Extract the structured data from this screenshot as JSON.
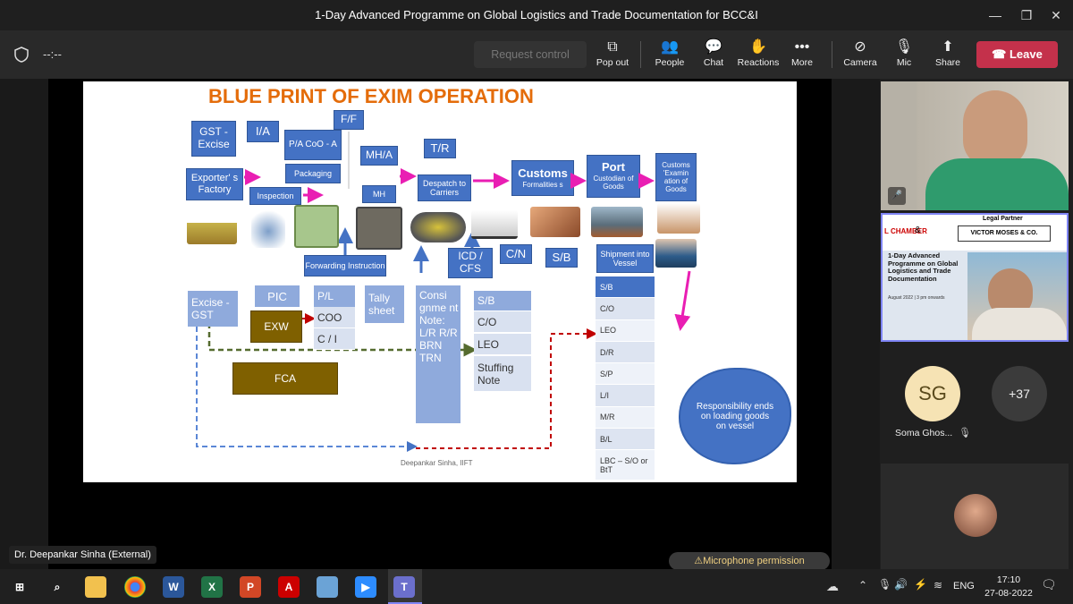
{
  "window": {
    "title": "1-Day Advanced Programme on Global Logistics and Trade Documentation for BCC&I"
  },
  "toolbar": {
    "timer": "--:--",
    "request_control": "Request control",
    "buttons": [
      {
        "label": "Pop out",
        "icon": "popout-icon"
      },
      {
        "label": "People",
        "icon": "people-icon"
      },
      {
        "label": "Chat",
        "icon": "chat-icon"
      },
      {
        "label": "Reactions",
        "icon": "reactions-icon"
      },
      {
        "label": "More",
        "icon": "more-icon"
      },
      {
        "label": "Camera",
        "icon": "camera-off-icon"
      },
      {
        "label": "Mic",
        "icon": "mic-off-icon"
      },
      {
        "label": "Share",
        "icon": "share-icon"
      }
    ],
    "leave": "Leave"
  },
  "slide": {
    "title": "BLUE PRINT OF EXIM OPERATION",
    "footer": "Deepankar Sinha, IIFT",
    "labels": {
      "gst_excise": "GST - Excise",
      "ia": "I/A",
      "ff": "F/F",
      "pa_coo": "P/A CoO - A",
      "mha": "MH/A",
      "tr": "T/R",
      "customs": "Customs",
      "formalities": "Formalities s",
      "port": "Port",
      "custodian": "Custodian of Goods",
      "customs_exam": "Customs 'Examin ation of Goods",
      "exporter": "Exporter' s Factory",
      "inspection": "Inspection",
      "packaging": "Packaging",
      "mh": "MH",
      "despatch": "Despatch to Carriers",
      "forwarding": "Forwarding Instruction",
      "icd": "ICD / CFS",
      "cn": "C/N",
      "sb_top": "S/B",
      "shipment": "Shipment into Vessel",
      "excise_gst": "Excise - GST",
      "pic": "PIC",
      "exw": "EXW",
      "pl": "P/L",
      "coo": "COO",
      "ci": "C / I",
      "tally": "Tally sheet",
      "fca": "FCA",
      "consignment": "Consi gnme nt Note: L/R R/R BRN TRN",
      "sb_mid": "S/B",
      "co": "C/O",
      "leo": "LEO",
      "stuffing": "Stuffing Note",
      "responsibility": "Responsibility ends on loading goods on vessel"
    },
    "doc_list": [
      "S/B",
      "C/O",
      "LEO",
      "D/R",
      "S/P",
      "L/I",
      "M/R",
      "B/L",
      "LBC – S/O or BtT"
    ]
  },
  "presenter": "Dr. Deepankar Sinha (External)",
  "mic_permission": "⚠Microphone permission",
  "participants": {
    "sg_initials": "SG",
    "sg_name": "Soma Ghos...",
    "more_count": "+37"
  },
  "video2": {
    "legal_partner": "Legal Partner",
    "victor": "VICTOR MOSES & CO.",
    "chamber": "L CHAMBER",
    "amp": "&",
    "programme": "1-Day Advanced Programme on Global Logistics and Trade Documentation",
    "date": "August 2022 | 3 pm onwards"
  },
  "taskbar": {
    "lang": "ENG",
    "time": "17:10",
    "date": "27-08-2022"
  }
}
